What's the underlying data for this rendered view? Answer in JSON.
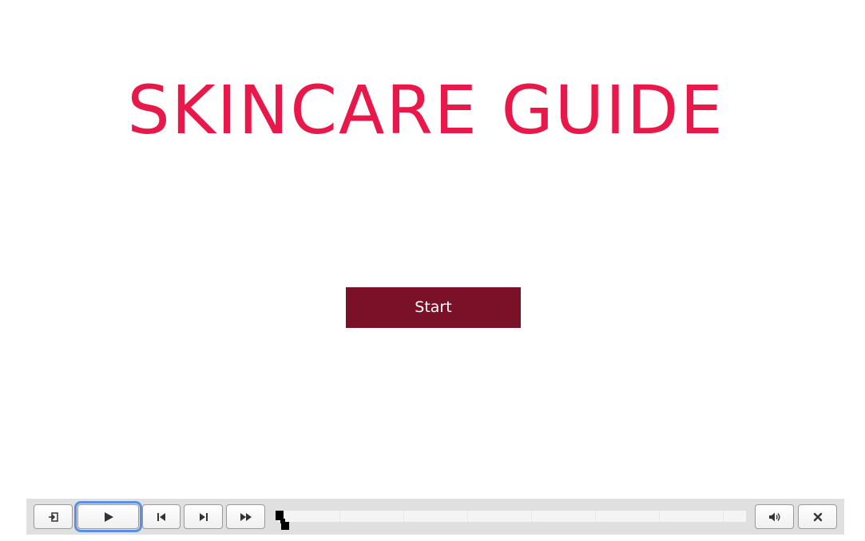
{
  "page": {
    "title": "SKINCARE GUIDE",
    "start_label": "Start"
  },
  "colors": {
    "title": "#e8194a",
    "start_button": "#7a1128",
    "toolbar_bg": "#e0e0e0",
    "focus_ring": "#5b8fe6"
  },
  "toolbar": {
    "buttons": [
      {
        "name": "exit-button",
        "icon": "exit-icon"
      },
      {
        "name": "play-button",
        "icon": "play-icon",
        "focused": true
      },
      {
        "name": "previous-button",
        "icon": "skip-previous-icon"
      },
      {
        "name": "next-button",
        "icon": "skip-next-icon"
      },
      {
        "name": "fast-forward-button",
        "icon": "fast-forward-icon"
      },
      {
        "name": "volume-button",
        "icon": "volume-icon"
      },
      {
        "name": "close-button",
        "icon": "close-icon"
      }
    ],
    "progress": 0
  }
}
